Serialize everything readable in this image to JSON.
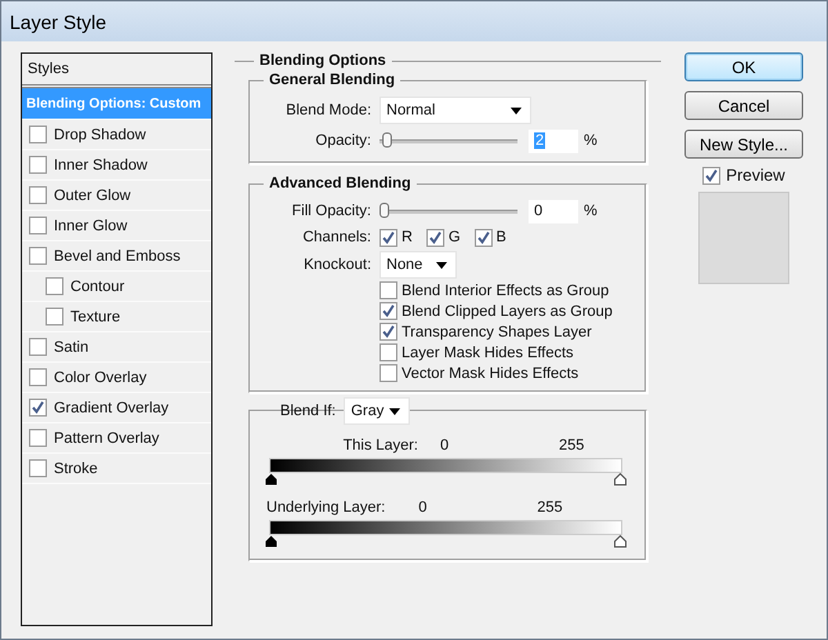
{
  "window": {
    "title": "Layer Style"
  },
  "styles_panel": {
    "header": "Styles",
    "items": [
      {
        "label": "Blending Options: Custom",
        "kind": "plain",
        "selected": true
      },
      {
        "label": "Drop Shadow",
        "kind": "check",
        "checked": false,
        "selected": false
      },
      {
        "label": "Inner Shadow",
        "kind": "check",
        "checked": false,
        "selected": false
      },
      {
        "label": "Outer Glow",
        "kind": "check",
        "checked": false,
        "selected": false
      },
      {
        "label": "Inner Glow",
        "kind": "check",
        "checked": false,
        "selected": false
      },
      {
        "label": "Bevel and Emboss",
        "kind": "check",
        "checked": false,
        "selected": false,
        "children": [
          {
            "label": "Contour",
            "kind": "check",
            "checked": false,
            "selected": false
          },
          {
            "label": "Texture",
            "kind": "check",
            "checked": false,
            "selected": false
          }
        ]
      },
      {
        "label": "Satin",
        "kind": "check",
        "checked": false,
        "selected": false
      },
      {
        "label": "Color Overlay",
        "kind": "check",
        "checked": false,
        "selected": false
      },
      {
        "label": "Gradient Overlay",
        "kind": "check",
        "checked": true,
        "selected": false
      },
      {
        "label": "Pattern Overlay",
        "kind": "check",
        "checked": false,
        "selected": false
      },
      {
        "label": "Stroke",
        "kind": "check",
        "checked": false,
        "selected": false
      }
    ]
  },
  "blending_options": {
    "title": "Blending Options",
    "general": {
      "title": "General Blending",
      "blend_mode": {
        "label": "Blend Mode:",
        "value": "Normal"
      },
      "opacity": {
        "label": "Opacity:",
        "level": 0.02,
        "value": "2",
        "text_selected": true,
        "unit": "%"
      }
    },
    "advanced": {
      "title": "Advanced Blending",
      "fill_opacity": {
        "label": "Fill Opacity:",
        "level": 0,
        "value": "0",
        "text_selected": false,
        "unit": "%"
      },
      "channels": {
        "label": "Channels:",
        "items": [
          {
            "label": "R",
            "checked": true
          },
          {
            "label": "G",
            "checked": true
          },
          {
            "label": "B",
            "checked": true
          }
        ]
      },
      "knockout": {
        "label": "Knockout:",
        "value": "None"
      },
      "options": [
        {
          "label": "Blend Interior Effects as Group",
          "checked": false
        },
        {
          "label": "Blend Clipped Layers as Group",
          "checked": true
        },
        {
          "label": "Transparency Shapes Layer",
          "checked": true
        },
        {
          "label": "Layer Mask Hides Effects",
          "checked": false
        },
        {
          "label": "Vector Mask Hides Effects",
          "checked": false
        }
      ]
    },
    "blend_if": {
      "label": "Blend If:",
      "value": "Gray",
      "sliders": [
        {
          "label": "This Layer:",
          "low": "0",
          "high": "255"
        },
        {
          "label": "Underlying Layer:",
          "low": "0",
          "high": "255"
        }
      ]
    }
  },
  "buttons": [
    {
      "label": "OK",
      "kind": "default"
    },
    {
      "label": "Cancel",
      "kind": "normal"
    },
    {
      "label": "New Style...",
      "kind": "normal"
    }
  ],
  "preview": {
    "label": "Preview",
    "checked": true
  }
}
